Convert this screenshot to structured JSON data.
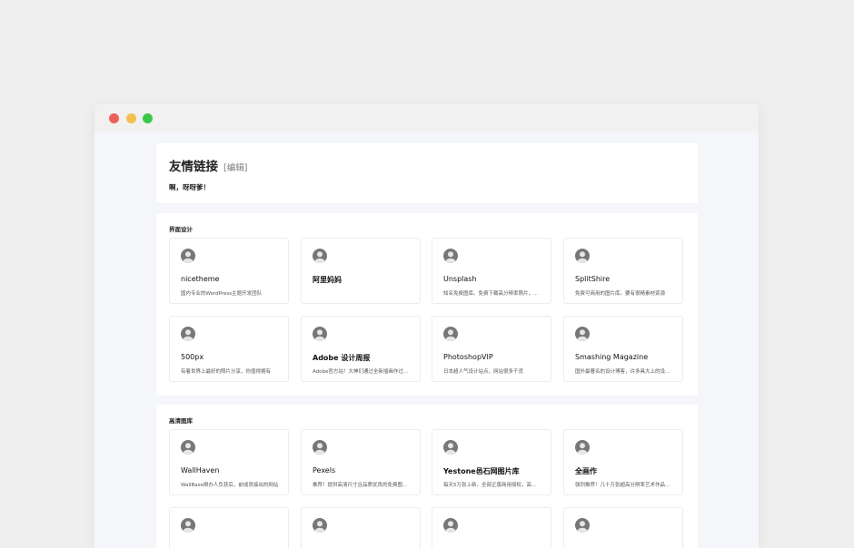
{
  "page": {
    "title": "友情链接",
    "edit_label": "[编辑]",
    "description": "啊，呀呀爹！"
  },
  "sections": [
    {
      "title": "界面设计",
      "cards": [
        {
          "name": "nicetheme",
          "desc": "国内专业的WordPress主题开发团队",
          "icon": "user-avatar-icon"
        },
        {
          "name": "阿里妈妈",
          "desc": "",
          "icon": "user-avatar-icon"
        },
        {
          "name": "Unsplash",
          "desc": "知名免费图库。免费下载高分辨率照片，...",
          "icon": "user-avatar-icon"
        },
        {
          "name": "SplitShire",
          "desc": "免费可商用的图片库。要有很精素材资源",
          "icon": "user-avatar-icon"
        },
        {
          "name": "500px",
          "desc": "有着世界上最好的照片分享，你值得拥有",
          "icon": "user-avatar-icon"
        },
        {
          "name": "Adobe 设计周报",
          "desc": "Adobe官方站！大神们通过全新插画作过...",
          "icon": "user-avatar-icon"
        },
        {
          "name": "PhotoshopVIP",
          "desc": "日本超人气设计站点，网站很多干货",
          "icon": "user-avatar-icon"
        },
        {
          "name": "Smashing Magazine",
          "desc": "国外最著名的设计博客，许多具大上的设...",
          "icon": "user-avatar-icon"
        }
      ]
    },
    {
      "title": "高清图库",
      "cards": [
        {
          "name": "WallHaven",
          "desc": "WallBase倒办人负获后，前成员接出的网站",
          "icon": "user-avatar-icon"
        },
        {
          "name": "Pexels",
          "desc": "推荐！提供高清尺寸且品质优良的免费图...",
          "icon": "user-avatar-icon"
        },
        {
          "name": "Yestone邑石网图片库",
          "desc": "每天5万张上新，全部正版商用授权，高...",
          "icon": "user-avatar-icon"
        },
        {
          "name": "全画作",
          "desc": "强烈推荐！几十万张超高分辨率艺术作品...",
          "icon": "user-avatar-icon"
        },
        {
          "name": "",
          "desc": "",
          "icon": "user-avatar-icon"
        },
        {
          "name": "",
          "desc": "",
          "icon": "user-avatar-icon"
        },
        {
          "name": "",
          "desc": "",
          "icon": "user-avatar-icon"
        },
        {
          "name": "",
          "desc": "",
          "icon": "user-avatar-icon"
        }
      ]
    }
  ],
  "colors": {
    "close": "#ed5f5b",
    "minimize": "#f6be4f",
    "maximize": "#3cc649",
    "avatar": "#777777"
  }
}
